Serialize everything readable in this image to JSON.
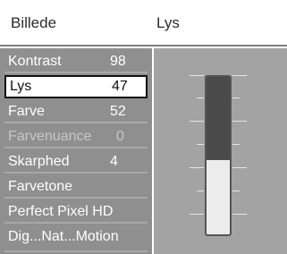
{
  "header": {
    "menu_title": "Billede",
    "selected_title": "Lys"
  },
  "menu": [
    {
      "label": "Kontrast",
      "value": "98",
      "state": "normal"
    },
    {
      "label": "Lys",
      "value": "47",
      "state": "selected"
    },
    {
      "label": "Farve",
      "value": "52",
      "state": "normal"
    },
    {
      "label": "Farvenuance",
      "value": "0",
      "state": "dim"
    },
    {
      "label": "Skarphed",
      "value": "4",
      "state": "normal"
    },
    {
      "label": "Farvetone",
      "value": "",
      "state": "normal"
    },
    {
      "label": "Perfect Pixel HD",
      "value": "",
      "state": "normal"
    },
    {
      "label": "Dig...Nat...Motion",
      "value": "",
      "state": "normal"
    }
  ],
  "slider": {
    "level_percent": 47
  },
  "colors": {
    "menu_bg": "#8f8f8f",
    "panel_bg": "#a3a3a3",
    "selected_bg": "#ffffff"
  }
}
